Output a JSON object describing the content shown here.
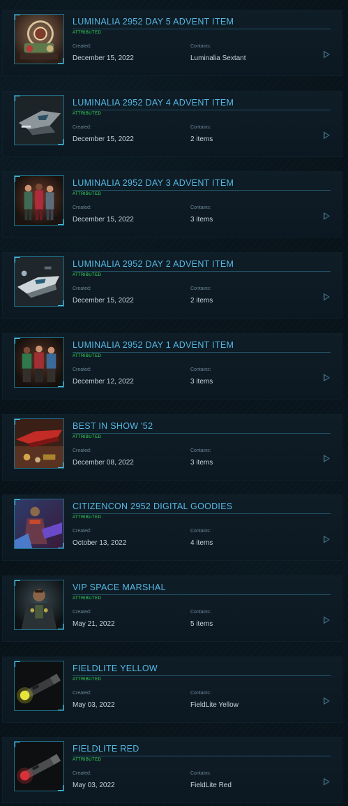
{
  "labels": {
    "created": "Created:",
    "contains": "Contains:",
    "status": "ATTRIBUTED"
  },
  "items": [
    {
      "title": "LUMINALIA 2952 DAY 5 ADVENT ITEM",
      "created": "December 15, 2022",
      "contains": "Luminalia Sextant",
      "thumb": "ornate-sextant"
    },
    {
      "title": "LUMINALIA 2952 DAY 4 ADVENT ITEM",
      "created": "December 15, 2022",
      "contains": "2 items",
      "thumb": "grey-ship"
    },
    {
      "title": "LUMINALIA 2952 DAY 3 ADVENT ITEM",
      "created": "December 15, 2022",
      "contains": "3 items",
      "thumb": "outfits-trio"
    },
    {
      "title": "LUMINALIA 2952 DAY 2 ADVENT ITEM",
      "created": "December 15, 2022",
      "contains": "2 items",
      "thumb": "white-ship"
    },
    {
      "title": "LUMINALIA 2952 DAY 1 ADVENT ITEM",
      "created": "December 12, 2022",
      "contains": "3 items",
      "thumb": "shirts-trio"
    },
    {
      "title": "BEST IN SHOW '52",
      "created": "December 08, 2022",
      "contains": "3 items",
      "thumb": "red-ship"
    },
    {
      "title": "CITIZENCON 2952 DIGITAL GOODIES",
      "created": "October 13, 2022",
      "contains": "4 items",
      "thumb": "armored-figure"
    },
    {
      "title": "VIP SPACE MARSHAL",
      "created": "May 21, 2022",
      "contains": "5 items",
      "thumb": "marshal-portrait"
    },
    {
      "title": "FIELDLITE YELLOW",
      "created": "May 03, 2022",
      "contains": "FieldLite Yellow",
      "thumb": "yellow-flashlight"
    },
    {
      "title": "FIELDLITE RED",
      "created": "May 03, 2022",
      "contains": "FieldLite Red",
      "thumb": "red-flashlight"
    }
  ],
  "colors": {
    "title": "#55b8e3",
    "status": "#35e25b",
    "panel": "#0f1d27",
    "accent_border": "#4fc7e8"
  }
}
